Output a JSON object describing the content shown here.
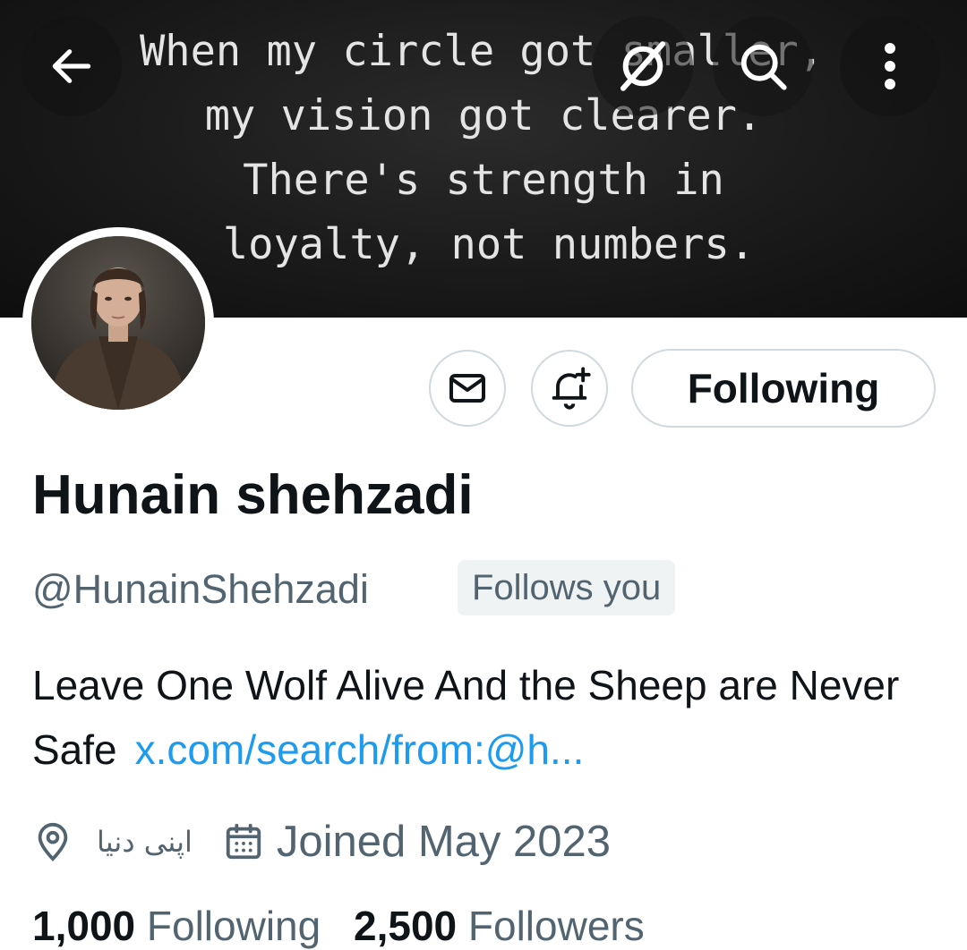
{
  "banner": {
    "quote_lines": [
      "When my circle got smaller,",
      "my vision got clearer.",
      "There's strength in",
      "loyalty, not numbers."
    ]
  },
  "top_bar": {
    "back_icon": "arrow-left-icon",
    "grok_icon": "grok-icon",
    "search_icon": "search-icon",
    "more_icon": "more-vertical-icon"
  },
  "actions": {
    "message_icon": "mail-icon",
    "notify_icon": "bell-plus-icon",
    "following_label": "Following"
  },
  "profile": {
    "display_name": "Hunain shehzadi",
    "handle": "@HunainShehzadi",
    "follows_you": "Follows you",
    "bio": "Leave One Wolf Alive And the Sheep are Never Safe",
    "bio_link": "x.com/search/from:@h...",
    "location": "اپنی دنیا",
    "joined": "Joined May 2023"
  },
  "stats": {
    "following_count": "1,000",
    "following_label": "Following",
    "followers_count": "2,500",
    "followers_label": "Followers"
  },
  "colors": {
    "accent": "#1d9bf0",
    "muted": "#536471",
    "border": "#cfd9de"
  }
}
